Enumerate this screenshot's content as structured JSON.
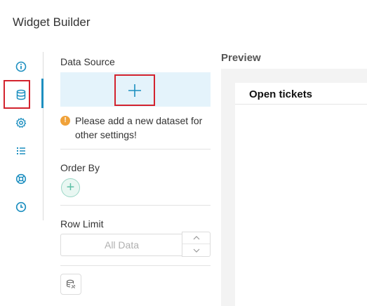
{
  "app": {
    "title": "Widget Builder"
  },
  "rail": {
    "items": [
      {
        "name": "info-icon"
      },
      {
        "name": "database-icon",
        "active": true
      },
      {
        "name": "gear-icon"
      },
      {
        "name": "list-icon"
      },
      {
        "name": "lifebuoy-icon"
      },
      {
        "name": "clock-icon"
      }
    ],
    "accent": "#1d8fc0",
    "highlight": "#d3232e"
  },
  "data_source": {
    "label": "Data Source",
    "add_icon": "plus-icon",
    "hint": "Please add a new dataset for other settings!",
    "hint_icon": "exclamation-icon"
  },
  "order_by": {
    "label": "Order By",
    "add_icon": "plus-icon",
    "add_glyph": "+"
  },
  "row_limit": {
    "label": "Row Limit",
    "placeholder": "All Data"
  },
  "sql_button": {
    "icon": "sql-icon"
  },
  "preview": {
    "title": "Preview",
    "card_title": "Open tickets"
  }
}
